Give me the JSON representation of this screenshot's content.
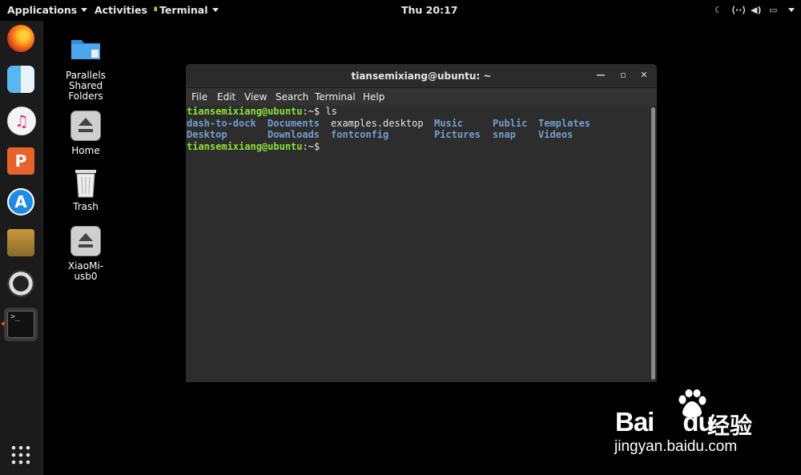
{
  "topbar": {
    "applications": "Applications",
    "activities": "Activities",
    "app_menu": "Terminal",
    "clock": "Thu 20:17"
  },
  "dock": {
    "items": [
      "firefox-icon",
      "finder-icon",
      "itunes-icon",
      "powerpoint-icon",
      "app-store-icon",
      "installer-icon",
      "help-icon",
      "terminal-icon",
      "show-applications-icon"
    ]
  },
  "desktop": {
    "icons": [
      {
        "label": "Parallels\nShared\nFolders"
      },
      {
        "label": "Home"
      },
      {
        "label": "Trash"
      },
      {
        "label": "XiaoMi-\nusb0"
      }
    ]
  },
  "window": {
    "title": "tiansemixiang@ubuntu: ~",
    "menu": [
      "File",
      "Edit",
      "View",
      "Search",
      "Terminal",
      "Help"
    ],
    "prompt": "tiansemixiang@ubuntu",
    "prompt_suffix": ":~$",
    "command": " ls",
    "ls_row1": [
      "dash-to-dock",
      "Documents",
      "examples.desktop",
      "Music",
      "Public",
      "Templates"
    ],
    "ls_row2": [
      "Desktop",
      "Downloads",
      "fontconfig",
      "Pictures",
      "snap",
      "Videos"
    ]
  },
  "watermark": {
    "brand": "Bai",
    "brand_end": "du",
    "cn": "经验",
    "url": "jingyan.baidu.com"
  },
  "colors": {
    "prompt": "#8ae234",
    "directory": "#729fcf",
    "terminal_bg": "#2d2d2d"
  }
}
